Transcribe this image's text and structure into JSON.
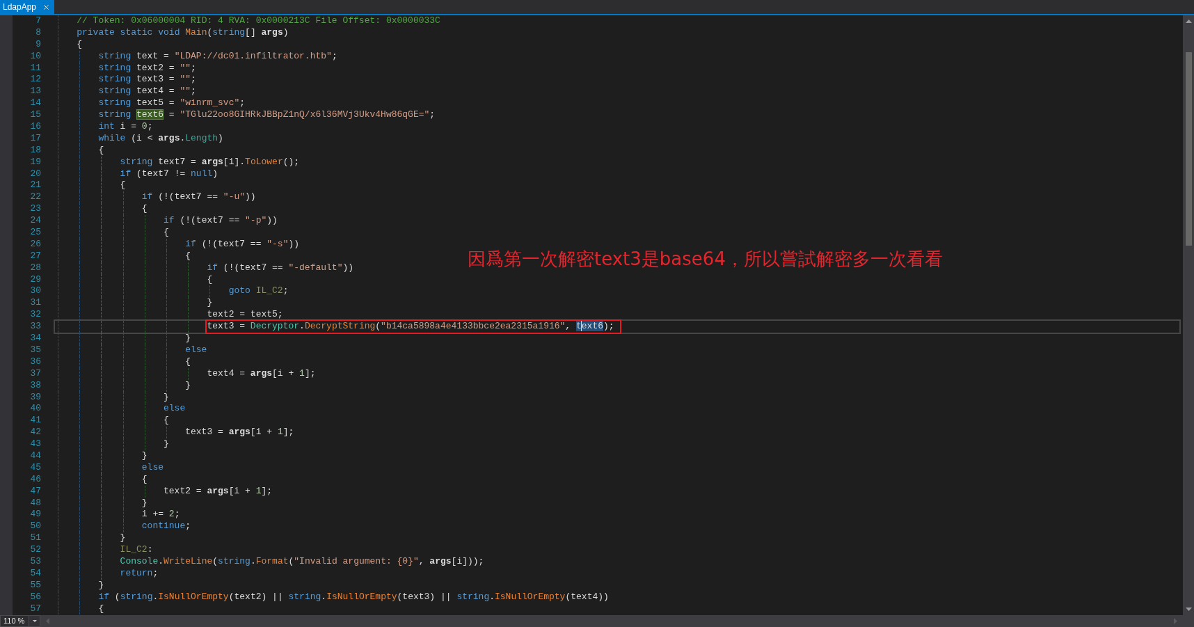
{
  "tabs": [
    {
      "label": "LdapApp",
      "selected": true
    }
  ],
  "editor": {
    "lines": [
      {
        "number": "7",
        "current": false,
        "boxed": false,
        "tokens": [
          {
            "kind": "comment",
            "text": "// Token: 0x06000004 RID: 4 RVA: 0x0000213C File Offset: 0x0000033C"
          }
        ]
      },
      {
        "number": "8",
        "current": false,
        "boxed": false,
        "tokens": [
          {
            "kind": "keyword",
            "text": "private static void "
          },
          {
            "kind": "method",
            "text": "Main"
          },
          {
            "kind": "plain",
            "text": "("
          },
          {
            "kind": "keyword",
            "text": "string"
          },
          {
            "kind": "plain",
            "text": "[] "
          },
          {
            "kind": "parameter",
            "text": "args"
          },
          {
            "kind": "plain",
            "text": ")"
          }
        ]
      },
      {
        "number": "9",
        "current": false,
        "boxed": false,
        "tokens": [
          {
            "kind": "plain",
            "text": "{"
          }
        ],
        "children": [
          {
            "number": "10",
            "current": false,
            "boxed": false,
            "tokens": [
              {
                "kind": "keyword",
                "text": "string"
              },
              {
                "kind": "plain",
                "text": " text = "
              },
              {
                "kind": "string",
                "text": "\"LDAP://dc01.infiltrator.htb\""
              },
              {
                "kind": "plain",
                "text": ";"
              }
            ]
          },
          {
            "number": "11",
            "current": false,
            "boxed": false,
            "tokens": [
              {
                "kind": "keyword",
                "text": "string"
              },
              {
                "kind": "plain",
                "text": " text2 = "
              },
              {
                "kind": "string",
                "text": "\"\""
              },
              {
                "kind": "plain",
                "text": ";"
              }
            ]
          },
          {
            "number": "12",
            "current": false,
            "boxed": false,
            "tokens": [
              {
                "kind": "keyword",
                "text": "string"
              },
              {
                "kind": "plain",
                "text": " text3 = "
              },
              {
                "kind": "string",
                "text": "\"\""
              },
              {
                "kind": "plain",
                "text": ";"
              }
            ]
          },
          {
            "number": "13",
            "current": false,
            "boxed": false,
            "tokens": [
              {
                "kind": "keyword",
                "text": "string"
              },
              {
                "kind": "plain",
                "text": " text4 = "
              },
              {
                "kind": "string",
                "text": "\"\""
              },
              {
                "kind": "plain",
                "text": ";"
              }
            ]
          },
          {
            "number": "14",
            "current": false,
            "boxed": false,
            "tokens": [
              {
                "kind": "keyword",
                "text": "string"
              },
              {
                "kind": "plain",
                "text": " text5 = "
              },
              {
                "kind": "string",
                "text": "\"winrm_svc\""
              },
              {
                "kind": "plain",
                "text": ";"
              }
            ]
          },
          {
            "number": "15",
            "current": false,
            "boxed": false,
            "tokens": [
              {
                "kind": "keyword",
                "text": "string "
              },
              {
                "kind": "plain",
                "text": "text6",
                "highlighted": true
              },
              {
                "kind": "plain",
                "text": " = "
              },
              {
                "kind": "string",
                "text": "\"TGlu22oo8GIHRkJBBpZ1nQ/x6l36MVj3Ukv4Hw86qGE=\""
              },
              {
                "kind": "plain",
                "text": ";"
              }
            ]
          },
          {
            "number": "16",
            "current": false,
            "boxed": false,
            "tokens": [
              {
                "kind": "keyword",
                "text": "int"
              },
              {
                "kind": "plain",
                "text": " i = "
              },
              {
                "kind": "number",
                "text": "0"
              },
              {
                "kind": "plain",
                "text": ";"
              }
            ]
          },
          {
            "number": "17",
            "current": false,
            "boxed": false,
            "tokens": [
              {
                "kind": "keyword",
                "text": "while"
              },
              {
                "kind": "plain",
                "text": " (i < "
              },
              {
                "kind": "parameter",
                "text": "args"
              },
              {
                "kind": "plain",
                "text": "."
              },
              {
                "kind": "property",
                "text": "Length"
              },
              {
                "kind": "plain",
                "text": ")"
              }
            ]
          },
          {
            "number": "18",
            "current": false,
            "boxed": false,
            "tokens": [
              {
                "kind": "plain",
                "text": "{"
              }
            ],
            "children": [
              {
                "number": "19",
                "current": false,
                "boxed": false,
                "tokens": [
                  {
                    "kind": "keyword",
                    "text": "string"
                  },
                  {
                    "kind": "plain",
                    "text": " text7 = "
                  },
                  {
                    "kind": "parameter",
                    "text": "args"
                  },
                  {
                    "kind": "plain",
                    "text": "[i]."
                  },
                  {
                    "kind": "method",
                    "text": "ToLower"
                  },
                  {
                    "kind": "plain",
                    "text": "();"
                  }
                ]
              },
              {
                "number": "20",
                "current": false,
                "boxed": false,
                "tokens": [
                  {
                    "kind": "keyword",
                    "text": "if"
                  },
                  {
                    "kind": "plain",
                    "text": " (text7 != "
                  },
                  {
                    "kind": "keyword",
                    "text": "null"
                  },
                  {
                    "kind": "plain",
                    "text": ")"
                  }
                ]
              },
              {
                "number": "21",
                "current": false,
                "boxed": false,
                "tokens": [
                  {
                    "kind": "plain",
                    "text": "{"
                  }
                ],
                "children": [
                  {
                    "number": "22",
                    "current": false,
                    "boxed": false,
                    "tokens": [
                      {
                        "kind": "keyword",
                        "text": "if"
                      },
                      {
                        "kind": "plain",
                        "text": " (!(text7 == "
                      },
                      {
                        "kind": "string",
                        "text": "\"-u\""
                      },
                      {
                        "kind": "plain",
                        "text": "))"
                      }
                    ]
                  },
                  {
                    "number": "23",
                    "current": false,
                    "boxed": false,
                    "tokens": [
                      {
                        "kind": "plain",
                        "text": "{"
                      }
                    ],
                    "children": [
                      {
                        "number": "24",
                        "current": false,
                        "boxed": false,
                        "tokens": [
                          {
                            "kind": "keyword",
                            "text": "if"
                          },
                          {
                            "kind": "plain",
                            "text": " (!(text7 == "
                          },
                          {
                            "kind": "string",
                            "text": "\"-p\""
                          },
                          {
                            "kind": "plain",
                            "text": "))"
                          }
                        ]
                      },
                      {
                        "number": "25",
                        "current": false,
                        "boxed": false,
                        "tokens": [
                          {
                            "kind": "plain",
                            "text": "{"
                          }
                        ],
                        "children": [
                          {
                            "number": "26",
                            "current": false,
                            "boxed": false,
                            "tokens": [
                              {
                                "kind": "keyword",
                                "text": "if"
                              },
                              {
                                "kind": "plain",
                                "text": " (!(text7 == "
                              },
                              {
                                "kind": "string",
                                "text": "\"-s\""
                              },
                              {
                                "kind": "plain",
                                "text": "))"
                              }
                            ]
                          },
                          {
                            "number": "27",
                            "current": false,
                            "boxed": false,
                            "tokens": [
                              {
                                "kind": "plain",
                                "text": "{"
                              }
                            ],
                            "children": [
                              {
                                "number": "28",
                                "current": false,
                                "boxed": false,
                                "tokens": [
                                  {
                                    "kind": "keyword",
                                    "text": "if"
                                  },
                                  {
                                    "kind": "plain",
                                    "text": " (!(text7 == "
                                  },
                                  {
                                    "kind": "string",
                                    "text": "\"-default\""
                                  },
                                  {
                                    "kind": "plain",
                                    "text": "))"
                                  }
                                ]
                              },
                              {
                                "number": "29",
                                "current": false,
                                "boxed": false,
                                "tokens": [
                                  {
                                    "kind": "plain",
                                    "text": "{"
                                  }
                                ],
                                "children": [
                                  {
                                    "number": "30",
                                    "current": false,
                                    "boxed": false,
                                    "tokens": [
                                      {
                                        "kind": "keyword",
                                        "text": "goto "
                                      },
                                      {
                                        "kind": "label",
                                        "text": "IL_C2"
                                      },
                                      {
                                        "kind": "plain",
                                        "text": ";"
                                      }
                                    ]
                                  }
                                ]
                              },
                              {
                                "number": "31",
                                "current": false,
                                "boxed": false,
                                "tokens": [
                                  {
                                    "kind": "plain",
                                    "text": "}"
                                  }
                                ]
                              },
                              {
                                "number": "32",
                                "current": false,
                                "boxed": false,
                                "tokens": [
                                  {
                                    "kind": "plain",
                                    "text": "text2 = text5;"
                                  }
                                ]
                              },
                              {
                                "number": "33",
                                "current": true,
                                "boxed": true,
                                "tokens": [
                                  {
                                    "kind": "plain",
                                    "text": "text3 = "
                                  },
                                  {
                                    "kind": "type",
                                    "text": "Decryptor"
                                  },
                                  {
                                    "kind": "plain",
                                    "text": "."
                                  },
                                  {
                                    "kind": "method",
                                    "text": "DecryptString"
                                  },
                                  {
                                    "kind": "plain",
                                    "text": "("
                                  },
                                  {
                                    "kind": "string",
                                    "text": "\"b14ca5898a4e4133bbce2ea2315a1916\""
                                  },
                                  {
                                    "kind": "plain",
                                    "text": ", "
                                  },
                                  {
                                    "kind": "plain",
                                    "text": "t",
                                    "in_selection": true,
                                    "caret": true
                                  },
                                  {
                                    "kind": "plain",
                                    "text": "ext6",
                                    "in_selection": true
                                  },
                                  {
                                    "kind": "plain",
                                    "text": ");"
                                  }
                                ]
                              }
                            ]
                          },
                          {
                            "number": "34",
                            "current": false,
                            "boxed": false,
                            "tokens": [
                              {
                                "kind": "plain",
                                "text": "}"
                              }
                            ]
                          },
                          {
                            "number": "35",
                            "current": false,
                            "boxed": false,
                            "tokens": [
                              {
                                "kind": "keyword",
                                "text": "else"
                              }
                            ]
                          },
                          {
                            "number": "36",
                            "current": false,
                            "boxed": false,
                            "tokens": [
                              {
                                "kind": "plain",
                                "text": "{"
                              }
                            ],
                            "children": [
                              {
                                "number": "37",
                                "current": false,
                                "boxed": false,
                                "tokens": [
                                  {
                                    "kind": "plain",
                                    "text": "text4 = "
                                  },
                                  {
                                    "kind": "parameter",
                                    "text": "args"
                                  },
                                  {
                                    "kind": "plain",
                                    "text": "[i + "
                                  },
                                  {
                                    "kind": "number",
                                    "text": "1"
                                  },
                                  {
                                    "kind": "plain",
                                    "text": "];"
                                  }
                                ]
                              }
                            ]
                          },
                          {
                            "number": "38",
                            "current": false,
                            "boxed": false,
                            "tokens": [
                              {
                                "kind": "plain",
                                "text": "}"
                              }
                            ]
                          }
                        ]
                      },
                      {
                        "number": "39",
                        "current": false,
                        "boxed": false,
                        "tokens": [
                          {
                            "kind": "plain",
                            "text": "}"
                          }
                        ]
                      },
                      {
                        "number": "40",
                        "current": false,
                        "boxed": false,
                        "tokens": [
                          {
                            "kind": "keyword",
                            "text": "else"
                          }
                        ]
                      },
                      {
                        "number": "41",
                        "current": false,
                        "boxed": false,
                        "tokens": [
                          {
                            "kind": "plain",
                            "text": "{"
                          }
                        ],
                        "children": [
                          {
                            "number": "42",
                            "current": false,
                            "boxed": false,
                            "tokens": [
                              {
                                "kind": "plain",
                                "text": "text3 = "
                              },
                              {
                                "kind": "parameter",
                                "text": "args"
                              },
                              {
                                "kind": "plain",
                                "text": "[i + "
                              },
                              {
                                "kind": "number",
                                "text": "1"
                              },
                              {
                                "kind": "plain",
                                "text": "];"
                              }
                            ]
                          }
                        ]
                      },
                      {
                        "number": "43",
                        "current": false,
                        "boxed": false,
                        "tokens": [
                          {
                            "kind": "plain",
                            "text": "}"
                          }
                        ]
                      }
                    ]
                  },
                  {
                    "number": "44",
                    "current": false,
                    "boxed": false,
                    "tokens": [
                      {
                        "kind": "plain",
                        "text": "}"
                      }
                    ]
                  },
                  {
                    "number": "45",
                    "current": false,
                    "boxed": false,
                    "tokens": [
                      {
                        "kind": "keyword",
                        "text": "else"
                      }
                    ]
                  },
                  {
                    "number": "46",
                    "current": false,
                    "boxed": false,
                    "tokens": [
                      {
                        "kind": "plain",
                        "text": "{"
                      }
                    ],
                    "children": [
                      {
                        "number": "47",
                        "current": false,
                        "boxed": false,
                        "tokens": [
                          {
                            "kind": "plain",
                            "text": "text2 = "
                          },
                          {
                            "kind": "parameter",
                            "text": "args"
                          },
                          {
                            "kind": "plain",
                            "text": "[i + "
                          },
                          {
                            "kind": "number",
                            "text": "1"
                          },
                          {
                            "kind": "plain",
                            "text": "];"
                          }
                        ]
                      }
                    ]
                  },
                  {
                    "number": "48",
                    "current": false,
                    "boxed": false,
                    "tokens": [
                      {
                        "kind": "plain",
                        "text": "}"
                      }
                    ]
                  },
                  {
                    "number": "49",
                    "current": false,
                    "boxed": false,
                    "tokens": [
                      {
                        "kind": "plain",
                        "text": "i += "
                      },
                      {
                        "kind": "number",
                        "text": "2"
                      },
                      {
                        "kind": "plain",
                        "text": ";"
                      }
                    ]
                  },
                  {
                    "number": "50",
                    "current": false,
                    "boxed": false,
                    "tokens": [
                      {
                        "kind": "keyword",
                        "text": "continue"
                      },
                      {
                        "kind": "plain",
                        "text": ";"
                      }
                    ]
                  }
                ]
              },
              {
                "number": "51",
                "current": false,
                "boxed": false,
                "tokens": [
                  {
                    "kind": "plain",
                    "text": "}"
                  }
                ]
              },
              {
                "number": "52",
                "current": false,
                "boxed": false,
                "tokens": [
                  {
                    "kind": "label",
                    "text": "IL_C2"
                  },
                  {
                    "kind": "plain",
                    "text": ":"
                  }
                ]
              },
              {
                "number": "53",
                "current": false,
                "boxed": false,
                "tokens": [
                  {
                    "kind": "type",
                    "text": "Console"
                  },
                  {
                    "kind": "plain",
                    "text": "."
                  },
                  {
                    "kind": "method",
                    "text": "WriteLine"
                  },
                  {
                    "kind": "plain",
                    "text": "("
                  },
                  {
                    "kind": "keyword",
                    "text": "string"
                  },
                  {
                    "kind": "plain",
                    "text": "."
                  },
                  {
                    "kind": "method",
                    "text": "Format"
                  },
                  {
                    "kind": "plain",
                    "text": "("
                  },
                  {
                    "kind": "string",
                    "text": "\"Invalid argument: {0}\""
                  },
                  {
                    "kind": "plain",
                    "text": ", "
                  },
                  {
                    "kind": "parameter",
                    "text": "args"
                  },
                  {
                    "kind": "plain",
                    "text": "[i]));"
                  }
                ]
              },
              {
                "number": "54",
                "current": false,
                "boxed": false,
                "tokens": [
                  {
                    "kind": "keyword",
                    "text": "return"
                  },
                  {
                    "kind": "plain",
                    "text": ";"
                  }
                ]
              }
            ]
          },
          {
            "number": "55",
            "current": false,
            "boxed": false,
            "tokens": [
              {
                "kind": "plain",
                "text": "}"
              }
            ]
          },
          {
            "number": "56",
            "current": false,
            "boxed": false,
            "tokens": [
              {
                "kind": "keyword",
                "text": "if"
              },
              {
                "kind": "plain",
                "text": " ("
              },
              {
                "kind": "keyword",
                "text": "string"
              },
              {
                "kind": "plain",
                "text": "."
              },
              {
                "kind": "method",
                "text": "IsNullOrEmpty"
              },
              {
                "kind": "plain",
                "text": "(text2) || "
              },
              {
                "kind": "keyword",
                "text": "string"
              },
              {
                "kind": "plain",
                "text": "."
              },
              {
                "kind": "method",
                "text": "IsNullOrEmpty"
              },
              {
                "kind": "plain",
                "text": "(text3) || "
              },
              {
                "kind": "keyword",
                "text": "string"
              },
              {
                "kind": "plain",
                "text": "."
              },
              {
                "kind": "method",
                "text": "IsNullOrEmpty"
              },
              {
                "kind": "plain",
                "text": "(text4))"
              }
            ]
          },
          {
            "number": "57",
            "current": false,
            "boxed": false,
            "tokens": [
              {
                "kind": "plain",
                "text": "{"
              }
            ]
          }
        ]
      }
    ]
  },
  "annotation": {
    "text": "因爲第一次解密text3是base64，所以嘗試解密多一次看看"
  },
  "status_bar": {
    "zoom": "110 %"
  }
}
